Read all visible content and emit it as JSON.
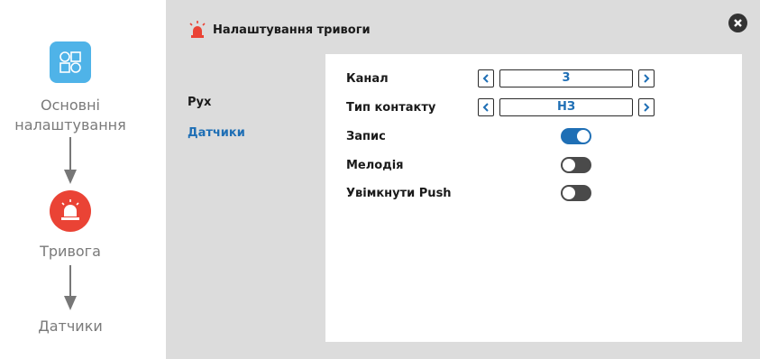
{
  "flow": {
    "steps": [
      {
        "label": "Основні налаштування",
        "icon": "settings-grid-icon"
      },
      {
        "label": "Тривога",
        "icon": "siren-icon"
      },
      {
        "label": "Датчики",
        "icon": ""
      }
    ]
  },
  "panel": {
    "title": "Налаштування тривоги",
    "title_icon": "siren-icon",
    "close_icon": "close-icon",
    "nav": [
      {
        "label": "Рух",
        "active": false
      },
      {
        "label": "Датчики",
        "active": true
      }
    ],
    "settings": {
      "channel": {
        "label": "Канал",
        "value": "3"
      },
      "contact_type": {
        "label": "Тип контакту",
        "value": "НЗ"
      },
      "record": {
        "label": "Запис",
        "enabled": true
      },
      "melody": {
        "label": "Мелодія",
        "enabled": false
      },
      "push": {
        "label": "Увімкнути Push",
        "enabled": false
      }
    }
  },
  "colors": {
    "accent": "#1f6fb5",
    "alarm_red": "#ea4335",
    "settings_blue": "#4fb3e8",
    "panel_bg": "#dcdcdc"
  }
}
